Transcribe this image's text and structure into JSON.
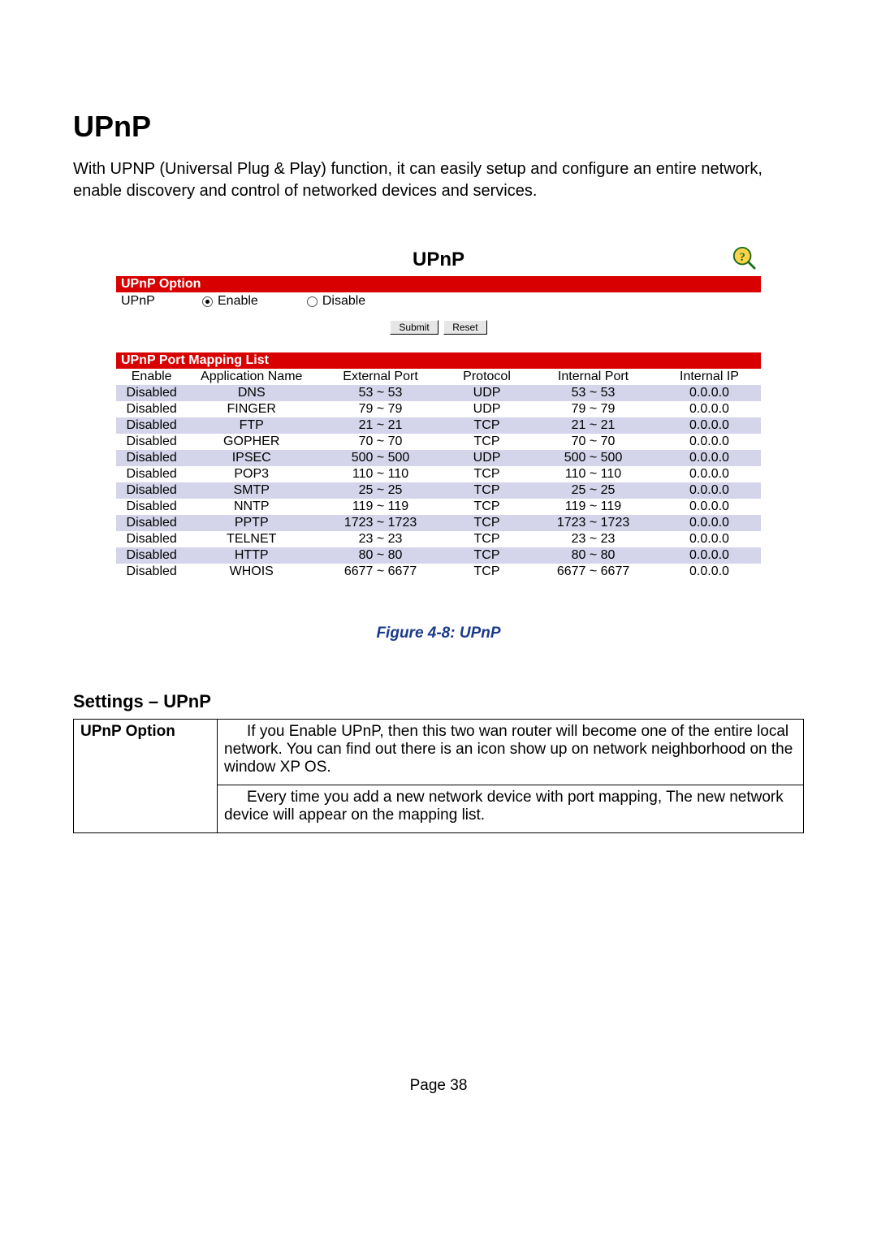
{
  "title": "UPnP",
  "intro": "With UPNP (Universal Plug & Play) function, it can easily setup and configure an entire network, enable discovery and control of networked devices and services.",
  "panel": {
    "heading": "UPnP",
    "option_bar": "UPnP Option",
    "row_label": "UPnP",
    "enable_label": "Enable",
    "disable_label": "Disable",
    "submit": "Submit",
    "reset": "Reset",
    "list_bar": "UPnP Port Mapping List",
    "headers": {
      "c1": "Enable",
      "c2": "Application Name",
      "c3": "External Port",
      "c4": "Protocol",
      "c5": "Internal Port",
      "c6": "Internal IP"
    },
    "rows": [
      {
        "en": "Disabled",
        "app": "DNS",
        "ext": "53 ~ 53",
        "proto": "UDP",
        "int": "53 ~ 53",
        "ip": "0.0.0.0"
      },
      {
        "en": "Disabled",
        "app": "FINGER",
        "ext": "79 ~ 79",
        "proto": "UDP",
        "int": "79 ~ 79",
        "ip": "0.0.0.0"
      },
      {
        "en": "Disabled",
        "app": "FTP",
        "ext": "21 ~ 21",
        "proto": "TCP",
        "int": "21 ~ 21",
        "ip": "0.0.0.0"
      },
      {
        "en": "Disabled",
        "app": "GOPHER",
        "ext": "70 ~ 70",
        "proto": "TCP",
        "int": "70 ~ 70",
        "ip": "0.0.0.0"
      },
      {
        "en": "Disabled",
        "app": "IPSEC",
        "ext": "500 ~ 500",
        "proto": "UDP",
        "int": "500 ~ 500",
        "ip": "0.0.0.0"
      },
      {
        "en": "Disabled",
        "app": "POP3",
        "ext": "110 ~ 110",
        "proto": "TCP",
        "int": "110 ~ 110",
        "ip": "0.0.0.0"
      },
      {
        "en": "Disabled",
        "app": "SMTP",
        "ext": "25 ~ 25",
        "proto": "TCP",
        "int": "25 ~ 25",
        "ip": "0.0.0.0"
      },
      {
        "en": "Disabled",
        "app": "NNTP",
        "ext": "119 ~ 119",
        "proto": "TCP",
        "int": "119 ~ 119",
        "ip": "0.0.0.0"
      },
      {
        "en": "Disabled",
        "app": "PPTP",
        "ext": "1723 ~ 1723",
        "proto": "TCP",
        "int": "1723 ~ 1723",
        "ip": "0.0.0.0"
      },
      {
        "en": "Disabled",
        "app": "TELNET",
        "ext": "23 ~ 23",
        "proto": "TCP",
        "int": "23 ~ 23",
        "ip": "0.0.0.0"
      },
      {
        "en": "Disabled",
        "app": "HTTP",
        "ext": "80 ~ 80",
        "proto": "TCP",
        "int": "80 ~ 80",
        "ip": "0.0.0.0"
      },
      {
        "en": "Disabled",
        "app": "WHOIS",
        "ext": "6677 ~ 6677",
        "proto": "TCP",
        "int": "6677 ~ 6677",
        "ip": "0.0.0.0"
      }
    ]
  },
  "caption": "Figure 4-8: UPnP",
  "settings_heading": "Settings – UPnP",
  "settings": {
    "key": "UPnP Option",
    "p1": "If you Enable UPnP, then this two wan router will become one of the entire local network. You can find out there is an  icon show up on network neighborhood on the window XP OS.",
    "p2": "Every time you add a new network device with port mapping, The new network device will appear on the mapping list."
  },
  "page_footer": "Page 38"
}
